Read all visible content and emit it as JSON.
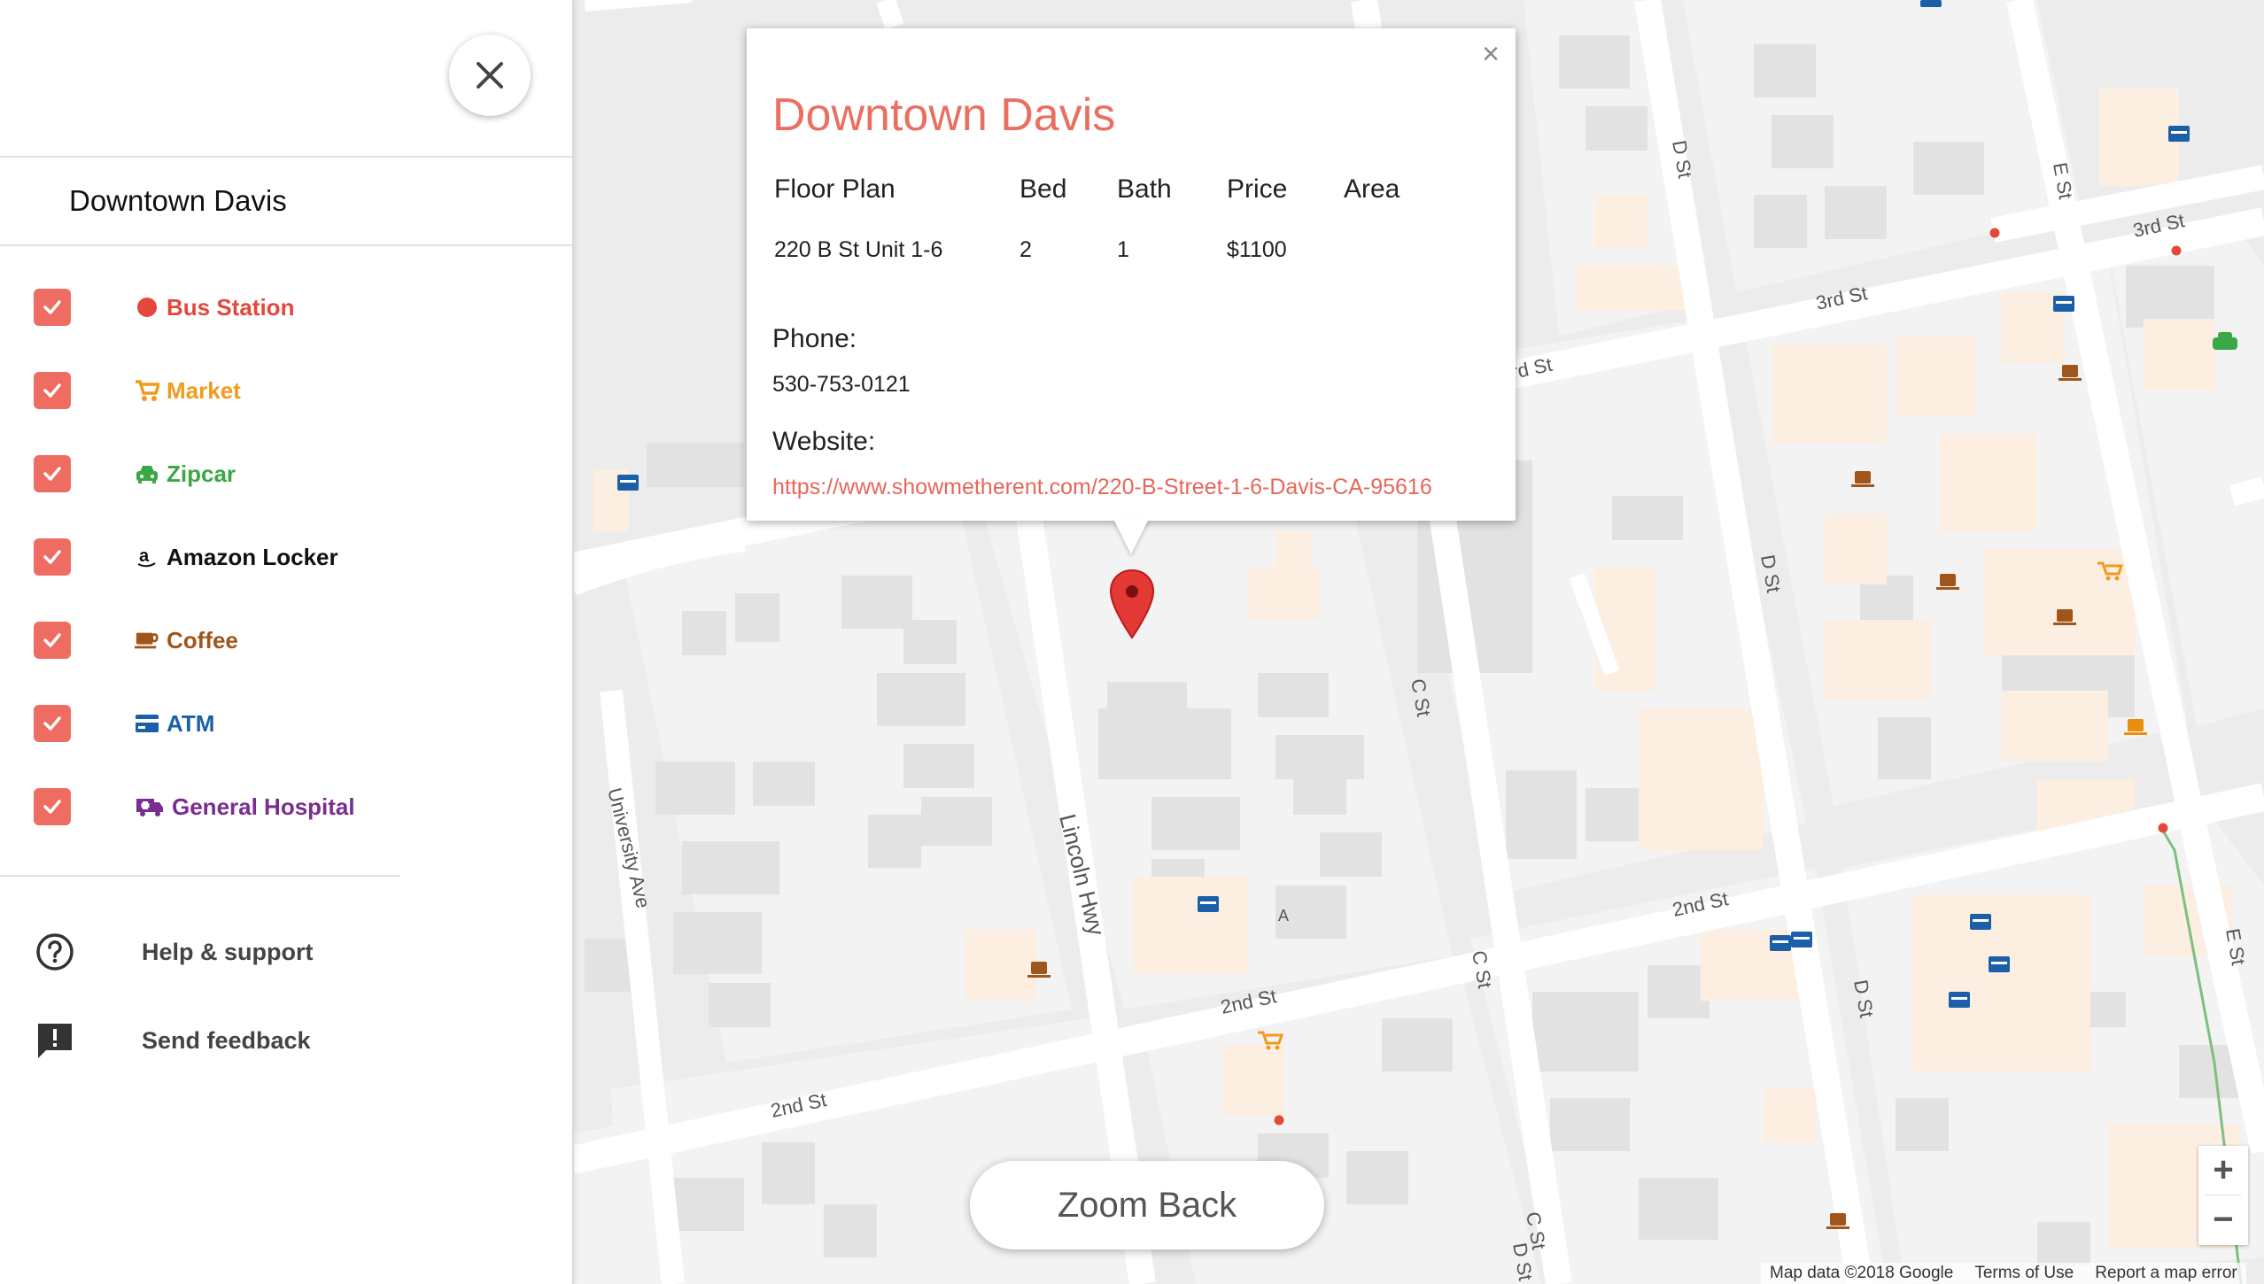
{
  "sidebar": {
    "search_value": "Downtown Davis",
    "categories": [
      {
        "label": "Bus Station",
        "color": "#e4473b",
        "icon": "circle-icon",
        "checked": true
      },
      {
        "label": "Market",
        "color": "#f19a1e",
        "icon": "cart-icon",
        "checked": true
      },
      {
        "label": "Zipcar",
        "color": "#3aa845",
        "icon": "car-icon",
        "checked": true
      },
      {
        "label": "Amazon Locker",
        "color": "#111111",
        "icon": "amazon-icon",
        "checked": true
      },
      {
        "label": "Coffee",
        "color": "#a0561a",
        "icon": "coffee-icon",
        "checked": true
      },
      {
        "label": "ATM",
        "color": "#1b5fa8",
        "icon": "atm-card-icon",
        "checked": true
      },
      {
        "label": "General Hospital",
        "color": "#7a2d91",
        "icon": "ambulance-icon",
        "checked": true
      }
    ],
    "menu": [
      {
        "label": "Help & support",
        "icon": "help-circle-icon"
      },
      {
        "label": "Send feedback",
        "icon": "feedback-icon"
      }
    ]
  },
  "popup": {
    "title": "Downtown Davis",
    "close_glyph": "×",
    "table_headers": [
      "Floor Plan",
      "Bed",
      "Bath",
      "Price",
      "Area"
    ],
    "rows": [
      {
        "floor_plan": "220 B St Unit 1-6",
        "bed": "2",
        "bath": "1",
        "price": "$1100",
        "area": ""
      }
    ],
    "phone_label": "Phone:",
    "phone": "530-753-0121",
    "website_label": "Website:",
    "website": "https://www.showmetherent.com/220-B-Street-1-6-Davis-CA-95616"
  },
  "map": {
    "street_labels": [
      "D St",
      "E St",
      "3rd St",
      "3rd St",
      "rd St",
      "D St",
      "C St",
      "D St",
      "2nd St",
      "C St",
      "D St",
      "E St",
      "2nd St",
      "2nd St",
      "C St",
      "Lincoln Hwy",
      "University Ave"
    ],
    "small_label": "A",
    "marker_color": "#e53935"
  },
  "zoom_back_label": "Zoom Back",
  "zoom_control": {
    "in": "+",
    "out": "−"
  },
  "attribution": {
    "map_data": "Map data ©2018 Google",
    "terms": "Terms of Use",
    "report": "Report a map error"
  },
  "colors": {
    "accent": "#ef6c62",
    "title": "#ea6f61",
    "link": "#e8665a",
    "road": "#ffffff",
    "building": "#e3e3e3",
    "building_beige": "#fcefe1",
    "map_bg": "#ececec"
  }
}
